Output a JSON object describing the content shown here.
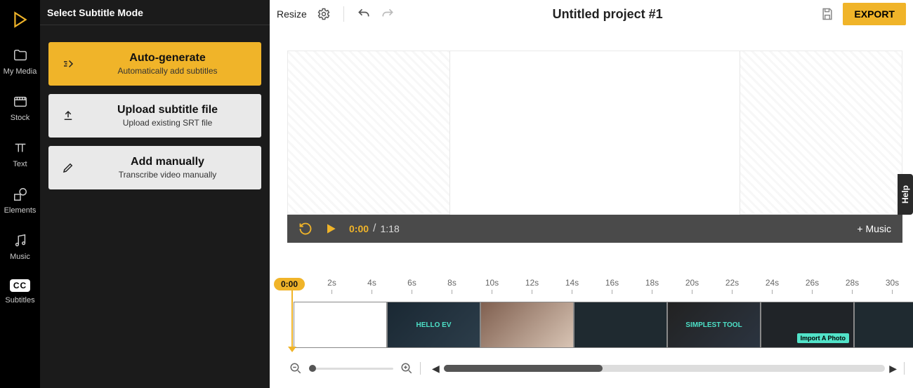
{
  "rail": {
    "my_media": "My Media",
    "stock": "Stock",
    "text": "Text",
    "elements": "Elements",
    "music": "Music",
    "subtitles": "Subtitles",
    "cc": "CC"
  },
  "sidepanel": {
    "title": "Select Subtitle Mode",
    "options": [
      {
        "title": "Auto-generate",
        "sub": "Automatically add subtitles"
      },
      {
        "title": "Upload subtitle file",
        "sub": "Upload existing SRT file"
      },
      {
        "title": "Add manually",
        "sub": "Transcribe video manually"
      }
    ]
  },
  "topbar": {
    "resize": "Resize",
    "title": "Untitled project #1",
    "export": "EXPORT"
  },
  "playbar": {
    "current": "0:00",
    "sep": "/",
    "duration": "1:18",
    "add_music": "+ Music"
  },
  "help": "Help",
  "timeline": {
    "playhead": "0:00",
    "ticks": [
      "2s",
      "4s",
      "6s",
      "8s",
      "10s",
      "12s",
      "14s",
      "16s",
      "18s",
      "20s",
      "22s",
      "24s",
      "26s",
      "28s",
      "30s"
    ],
    "clips": [
      {
        "label": ""
      },
      {
        "label": "HELLO EV"
      },
      {
        "label": ""
      },
      {
        "label": ""
      },
      {
        "label": "SIMPLEST TOOL"
      },
      {
        "label": "",
        "badge": "Import A Photo"
      },
      {
        "label": ""
      }
    ]
  }
}
